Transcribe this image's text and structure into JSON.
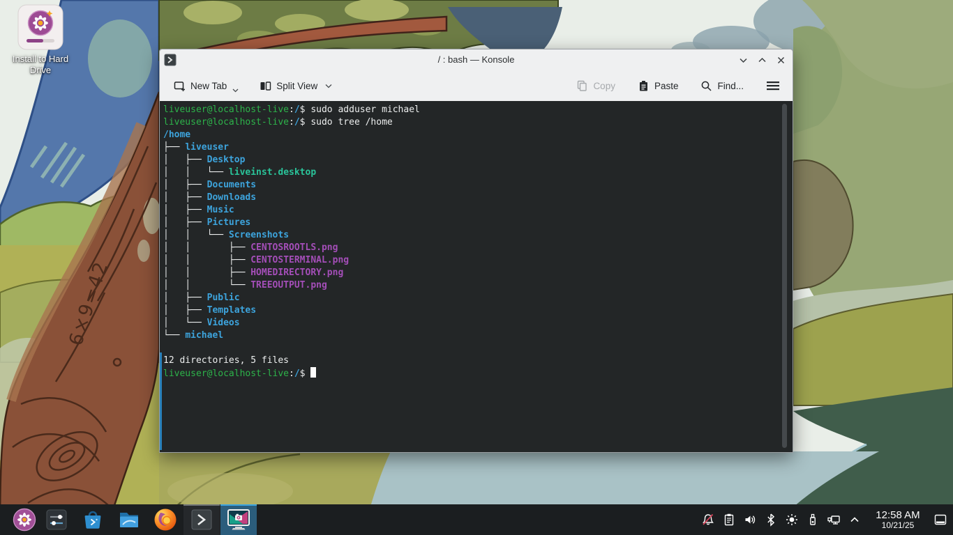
{
  "desktop": {
    "install_shortcut_label": "Install to Hard Drive"
  },
  "wallpaper": {
    "carving": "6×9=42",
    "palette": [
      "#e9eee8",
      "#5477ab",
      "#8a5138",
      "#6d7c45",
      "#b0b156",
      "#97a775",
      "#a9c2c6",
      "#405d4b"
    ]
  },
  "window": {
    "title": "/ : bash — Konsole",
    "controls": [
      "minimize",
      "maximize",
      "close"
    ],
    "toolbar": {
      "new_tab_label": "New Tab",
      "split_view_label": "Split View",
      "copy_label": "Copy",
      "paste_label": "Paste",
      "find_label": "Find..."
    }
  },
  "terminal": {
    "colors": {
      "background": "#232627",
      "foreground": "#eceeee",
      "prompt_green": "#2db34a",
      "directory_blue": "#3da4dd",
      "executable_teal": "#2ac49a",
      "image_magenta": "#a44eb8",
      "new_output_marker": "#2980b9"
    },
    "summary_line": "12 directories, 5 files",
    "lines": [
      {
        "segs": [
          {
            "t": "liveuser@localhost-live",
            "c": "g"
          },
          {
            "t": ":",
            "c": "f"
          },
          {
            "t": "/",
            "c": "b"
          },
          {
            "t": "$ ",
            "c": "f"
          },
          {
            "t": "sudo adduser michael",
            "c": "f"
          }
        ]
      },
      {
        "segs": [
          {
            "t": "liveuser@localhost-live",
            "c": "g"
          },
          {
            "t": ":",
            "c": "f"
          },
          {
            "t": "/",
            "c": "b"
          },
          {
            "t": "$ ",
            "c": "f"
          },
          {
            "t": "sudo tree /home",
            "c": "f"
          }
        ]
      },
      {
        "segs": [
          {
            "t": "/home",
            "c": "b"
          }
        ]
      },
      {
        "segs": [
          {
            "t": "├── ",
            "c": "f"
          },
          {
            "t": "liveuser",
            "c": "b"
          }
        ]
      },
      {
        "segs": [
          {
            "t": "│   ├── ",
            "c": "f"
          },
          {
            "t": "Desktop",
            "c": "b"
          }
        ]
      },
      {
        "segs": [
          {
            "t": "│   │   └── ",
            "c": "f"
          },
          {
            "t": "liveinst.desktop",
            "c": "t"
          }
        ]
      },
      {
        "segs": [
          {
            "t": "│   ├── ",
            "c": "f"
          },
          {
            "t": "Documents",
            "c": "b"
          }
        ]
      },
      {
        "segs": [
          {
            "t": "│   ├── ",
            "c": "f"
          },
          {
            "t": "Downloads",
            "c": "b"
          }
        ]
      },
      {
        "segs": [
          {
            "t": "│   ├── ",
            "c": "f"
          },
          {
            "t": "Music",
            "c": "b"
          }
        ]
      },
      {
        "segs": [
          {
            "t": "│   ├── ",
            "c": "f"
          },
          {
            "t": "Pictures",
            "c": "b"
          }
        ]
      },
      {
        "segs": [
          {
            "t": "│   │   └── ",
            "c": "f"
          },
          {
            "t": "Screenshots",
            "c": "b"
          }
        ]
      },
      {
        "segs": [
          {
            "t": "│   │       ├── ",
            "c": "f"
          },
          {
            "t": "CENTOSROOTLS.png",
            "c": "m"
          }
        ]
      },
      {
        "segs": [
          {
            "t": "│   │       ├── ",
            "c": "f"
          },
          {
            "t": "CENTOSTERMINAL.png",
            "c": "m"
          }
        ]
      },
      {
        "segs": [
          {
            "t": "│   │       ├── ",
            "c": "f"
          },
          {
            "t": "HOMEDIRECTORY.png",
            "c": "m"
          }
        ]
      },
      {
        "segs": [
          {
            "t": "│   │       └── ",
            "c": "f"
          },
          {
            "t": "TREEOUTPUT.png",
            "c": "m"
          }
        ]
      },
      {
        "segs": [
          {
            "t": "│   ├── ",
            "c": "f"
          },
          {
            "t": "Public",
            "c": "b"
          }
        ]
      },
      {
        "segs": [
          {
            "t": "│   ├── ",
            "c": "f"
          },
          {
            "t": "Templates",
            "c": "b"
          }
        ]
      },
      {
        "segs": [
          {
            "t": "│   └── ",
            "c": "f"
          },
          {
            "t": "Videos",
            "c": "b"
          }
        ]
      },
      {
        "segs": [
          {
            "t": "└── ",
            "c": "f"
          },
          {
            "t": "michael",
            "c": "b"
          }
        ]
      },
      {
        "segs": []
      },
      {
        "segs": [
          {
            "t": "12 directories, 5 files",
            "c": "f"
          }
        ]
      },
      {
        "segs": [
          {
            "t": "liveuser@localhost-live",
            "c": "g"
          },
          {
            "t": ":",
            "c": "f"
          },
          {
            "t": "/",
            "c": "b"
          },
          {
            "t": "$ ",
            "c": "f"
          }
        ],
        "cursor": true
      }
    ]
  },
  "taskbar": {
    "apps": [
      {
        "name": "application-launcher"
      },
      {
        "name": "system-settings"
      },
      {
        "name": "discover"
      },
      {
        "name": "dolphin-file-manager"
      },
      {
        "name": "firefox"
      },
      {
        "name": "konsole",
        "state": "open"
      },
      {
        "name": "spectacle",
        "state": "active"
      }
    ],
    "tray": [
      "notifications-dnd",
      "clipboard",
      "volume",
      "bluetooth",
      "brightness",
      "removable-device",
      "network",
      "expand-tray"
    ],
    "clock_time": "12:58 AM",
    "clock_date": "10/21/25",
    "accent": "#3daee9"
  }
}
